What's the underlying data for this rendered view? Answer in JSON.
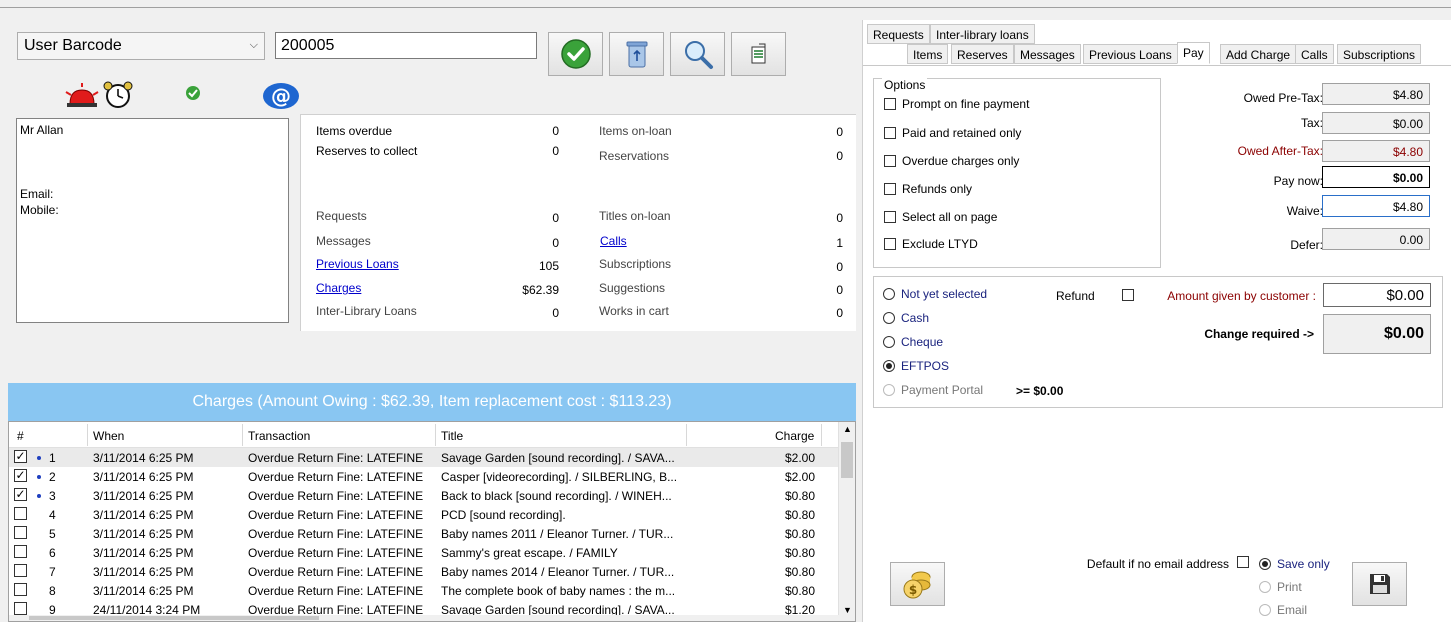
{
  "search": {
    "mode": "User Barcode",
    "value": "200005"
  },
  "patron": {
    "name": "Mr Allan",
    "email_label": "Email:",
    "mobile_label": "Mobile:"
  },
  "stats": {
    "left": [
      {
        "label": "Items overdue",
        "value": "0",
        "link": false,
        "dark": true
      },
      {
        "label": "Reserves to collect",
        "value": "0",
        "link": false,
        "dark": true
      },
      {
        "label": "Requests",
        "value": "0",
        "link": false,
        "dark": false
      },
      {
        "label": "Messages",
        "value": "0",
        "link": false,
        "dark": false
      },
      {
        "label": "Previous Loans",
        "value": "105",
        "link": true,
        "dark": false
      },
      {
        "label": "Charges",
        "value": "$62.39",
        "link": true,
        "dark": false
      },
      {
        "label": "Inter-Library Loans",
        "value": "0",
        "link": false,
        "dark": false
      }
    ],
    "right": [
      {
        "label": "Items on-loan",
        "value": "0",
        "link": false
      },
      {
        "label": "Reservations",
        "value": "0",
        "link": false
      },
      {
        "label": "Titles on-loan",
        "value": "0",
        "link": false
      },
      {
        "label": "Calls",
        "value": "1",
        "link": true
      },
      {
        "label": "Subscriptions",
        "value": "0",
        "link": false
      },
      {
        "label": "Suggestions",
        "value": "0",
        "link": false
      },
      {
        "label": "Works in cart",
        "value": "0",
        "link": false
      }
    ]
  },
  "charges": {
    "banner": "Charges (Amount Owing : $62.39, Item replacement cost : $113.23)",
    "columns": [
      "#",
      "When",
      "Transaction",
      "Title",
      "Charge"
    ],
    "rows": [
      {
        "num": "1",
        "when": "3/11/2014 6:25 PM",
        "transaction": "Overdue Return Fine: LATEFINE",
        "title": "Savage Garden [sound recording]. / SAVA...",
        "charge": "$2.00",
        "checked": true,
        "dot": true
      },
      {
        "num": "2",
        "when": "3/11/2014 6:25 PM",
        "transaction": "Overdue Return Fine: LATEFINE",
        "title": "Casper [videorecording]. / SILBERLING, B...",
        "charge": "$2.00",
        "checked": true,
        "dot": true
      },
      {
        "num": "3",
        "when": "3/11/2014 6:25 PM",
        "transaction": "Overdue Return Fine: LATEFINE",
        "title": "Back to black [sound recording]. / WINEH...",
        "charge": "$0.80",
        "checked": true,
        "dot": true
      },
      {
        "num": "4",
        "when": "3/11/2014 6:25 PM",
        "transaction": "Overdue Return Fine: LATEFINE",
        "title": "PCD [sound recording].",
        "charge": "$0.80",
        "checked": false,
        "dot": false
      },
      {
        "num": "5",
        "when": "3/11/2014 6:25 PM",
        "transaction": "Overdue Return Fine: LATEFINE",
        "title": "Baby names 2011 / Eleanor Turner. / TUR...",
        "charge": "$0.80",
        "checked": false,
        "dot": false
      },
      {
        "num": "6",
        "when": "3/11/2014 6:25 PM",
        "transaction": "Overdue Return Fine: LATEFINE",
        "title": "Sammy's great escape. / FAMILY",
        "charge": "$0.80",
        "checked": false,
        "dot": false
      },
      {
        "num": "7",
        "when": "3/11/2014 6:25 PM",
        "transaction": "Overdue Return Fine: LATEFINE",
        "title": "Baby names 2014 / Eleanor Turner. / TUR...",
        "charge": "$0.80",
        "checked": false,
        "dot": false
      },
      {
        "num": "8",
        "when": "3/11/2014 6:25 PM",
        "transaction": "Overdue Return Fine: LATEFINE",
        "title": "The complete book of baby names : the m...",
        "charge": "$0.80",
        "checked": false,
        "dot": false
      },
      {
        "num": "9",
        "when": "24/11/2014 3:24 PM",
        "transaction": "Overdue Return Fine: LATEFINE",
        "title": "Savage Garden [sound recording]. / SAVA...",
        "charge": "$1.20",
        "checked": false,
        "dot": false
      }
    ]
  },
  "tabs": {
    "row1": [
      "Requests",
      "Inter-library loans"
    ],
    "row2": [
      "Items",
      "Reserves",
      "Messages",
      "Previous Loans",
      "Pay",
      "Add Charge",
      "Calls",
      "Subscriptions"
    ],
    "active": "Pay"
  },
  "pay": {
    "options_title": "Options",
    "options": [
      "Prompt on fine payment",
      "Paid and retained only",
      "Overdue charges only",
      "Refunds only",
      "Select all on page",
      "Exclude LTYD"
    ],
    "owed_pretax_label": "Owed Pre-Tax:",
    "owed_pretax": "$4.80",
    "tax_label": "Tax:",
    "tax": "$0.00",
    "owed_aftertax_label": "Owed After-Tax:",
    "owed_aftertax": "$4.80",
    "pay_now_label": "Pay now:",
    "pay_now": "$0.00",
    "waive_label": "Waive:",
    "waive": "$4.80",
    "defer_label": "Defer:",
    "defer": "0.00",
    "methods": [
      "Not yet selected",
      "Cash",
      "Cheque",
      "EFTPOS",
      "Payment Portal"
    ],
    "selected_method": "EFTPOS",
    "portal_amount": ">= $0.00",
    "refund_label": "Refund",
    "amount_given_label": "Amount given by customer :",
    "amount_given": "$0.00",
    "change_label": "Change required ->",
    "change": "$0.00",
    "default_email_label": "Default if no email address",
    "receipt_options": [
      "Save only",
      "Print",
      "Email"
    ],
    "receipt_selected": "Save only"
  },
  "colors": {
    "banner": "#89c6f2",
    "link": "#0000cc",
    "dark_red": "#8b0000"
  }
}
